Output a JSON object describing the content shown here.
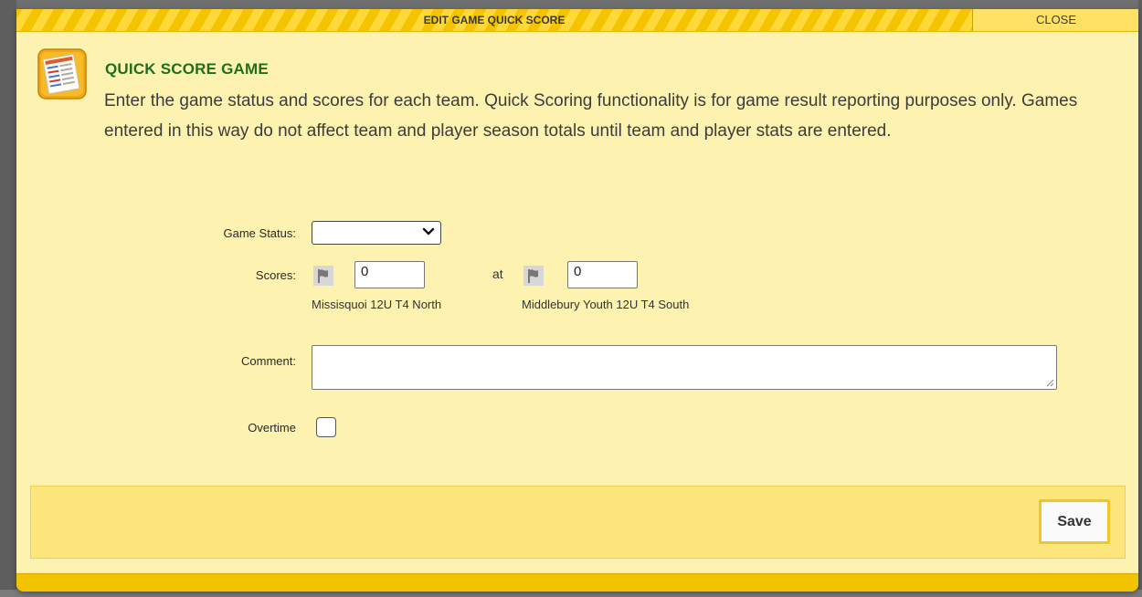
{
  "dialog": {
    "title": "EDIT GAME QUICK SCORE",
    "close_label": "CLOSE",
    "heading": "QUICK SCORE GAME",
    "description": "Enter the game status and scores for each team. Quick Scoring functionality is for game result reporting purposes only. Games entered in this way do not affect team and player season totals until team and player stats are entered."
  },
  "form": {
    "game_status_label": "Game Status:",
    "game_status_value": "",
    "scores_label": "Scores:",
    "home_team": {
      "name": "Missisquoi 12U T4 North",
      "score": "0"
    },
    "at_label": "at",
    "away_team": {
      "name": "Middlebury Youth 12U T4 South",
      "score": "0"
    },
    "comment_label": "Comment:",
    "comment_value": "",
    "overtime_label": "Overtime",
    "overtime_checked": false
  },
  "footer": {
    "save_label": "Save"
  },
  "colors": {
    "dialog_bg": "#fef2b0",
    "title_bar": "#f4c400",
    "heading_green": "#1e6e1e",
    "footer_bg": "#fde77c",
    "save_border": "#f2c629"
  },
  "icons": {
    "header": "scoresheet-icon",
    "team_flag": "flag-icon"
  }
}
